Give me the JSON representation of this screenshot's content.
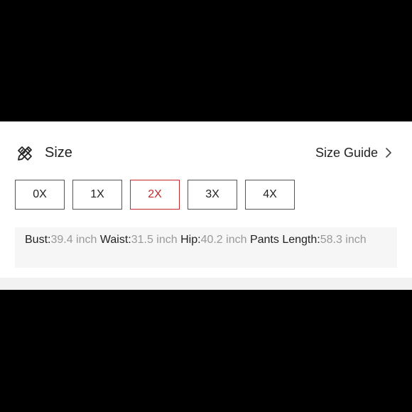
{
  "header": {
    "title": "Size",
    "guide_label": "Size Guide"
  },
  "sizes": [
    {
      "label": "0X",
      "selected": false
    },
    {
      "label": "1X",
      "selected": false
    },
    {
      "label": "2X",
      "selected": true
    },
    {
      "label": "3X",
      "selected": false
    },
    {
      "label": "4X",
      "selected": false
    }
  ],
  "measurements": {
    "bust_label": "Bust:",
    "bust_value": "39.4 inch",
    "waist_label": "Waist:",
    "waist_value": "31.5 inch",
    "hip_label": "Hip:",
    "hip_value": "40.2 inch",
    "pants_label": "Pants Length:",
    "pants_value": "58.3 inch"
  },
  "colors": {
    "selected_accent": "#c3272b",
    "muted_value": "#999999"
  },
  "icons": {
    "size_icon": "ruler-pencil-icon",
    "guide_icon": "chevron-right-icon"
  }
}
